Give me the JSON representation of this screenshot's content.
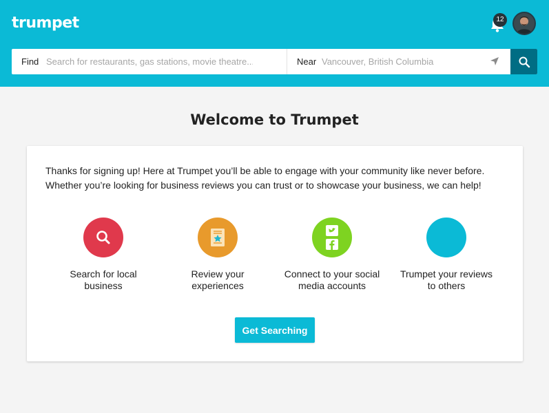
{
  "header": {
    "logo_text": "trumpet",
    "notifications_count": "12",
    "bg_color": "#0bbad6"
  },
  "search": {
    "find_label": "Find",
    "find_placeholder": "Search for restaurants, gas stations, movie theatre...",
    "near_label": "Near",
    "near_placeholder": "Vancouver, British Columbia"
  },
  "welcome": {
    "title": "Welcome to Trumpet",
    "intro_line1": "Thanks for signing up! Here at Trumpet you’ll be able to engage with your community like never before.",
    "intro_line2": "Whether you’re looking for business reviews you can trust or to showcase your business, we can help!",
    "features": [
      {
        "line1": "Search for local",
        "line2": "business",
        "icon": "search-icon",
        "color": "#e0394c"
      },
      {
        "line1": "Review your",
        "line2": "experiences",
        "icon": "review-star-icon",
        "color": "#e89a2c"
      },
      {
        "line1": "Connect to your social",
        "line2": "media accounts",
        "icon": "social-media-icon",
        "color": "#7ed321"
      },
      {
        "line1": "Trumpet your reviews",
        "line2": "to others",
        "icon": "trumpet-logo-icon",
        "color": "#0bbad6"
      }
    ],
    "cta_label": "Get Searching"
  },
  "colors": {
    "accent": "#0bbad6",
    "search_button": "#006d84"
  }
}
